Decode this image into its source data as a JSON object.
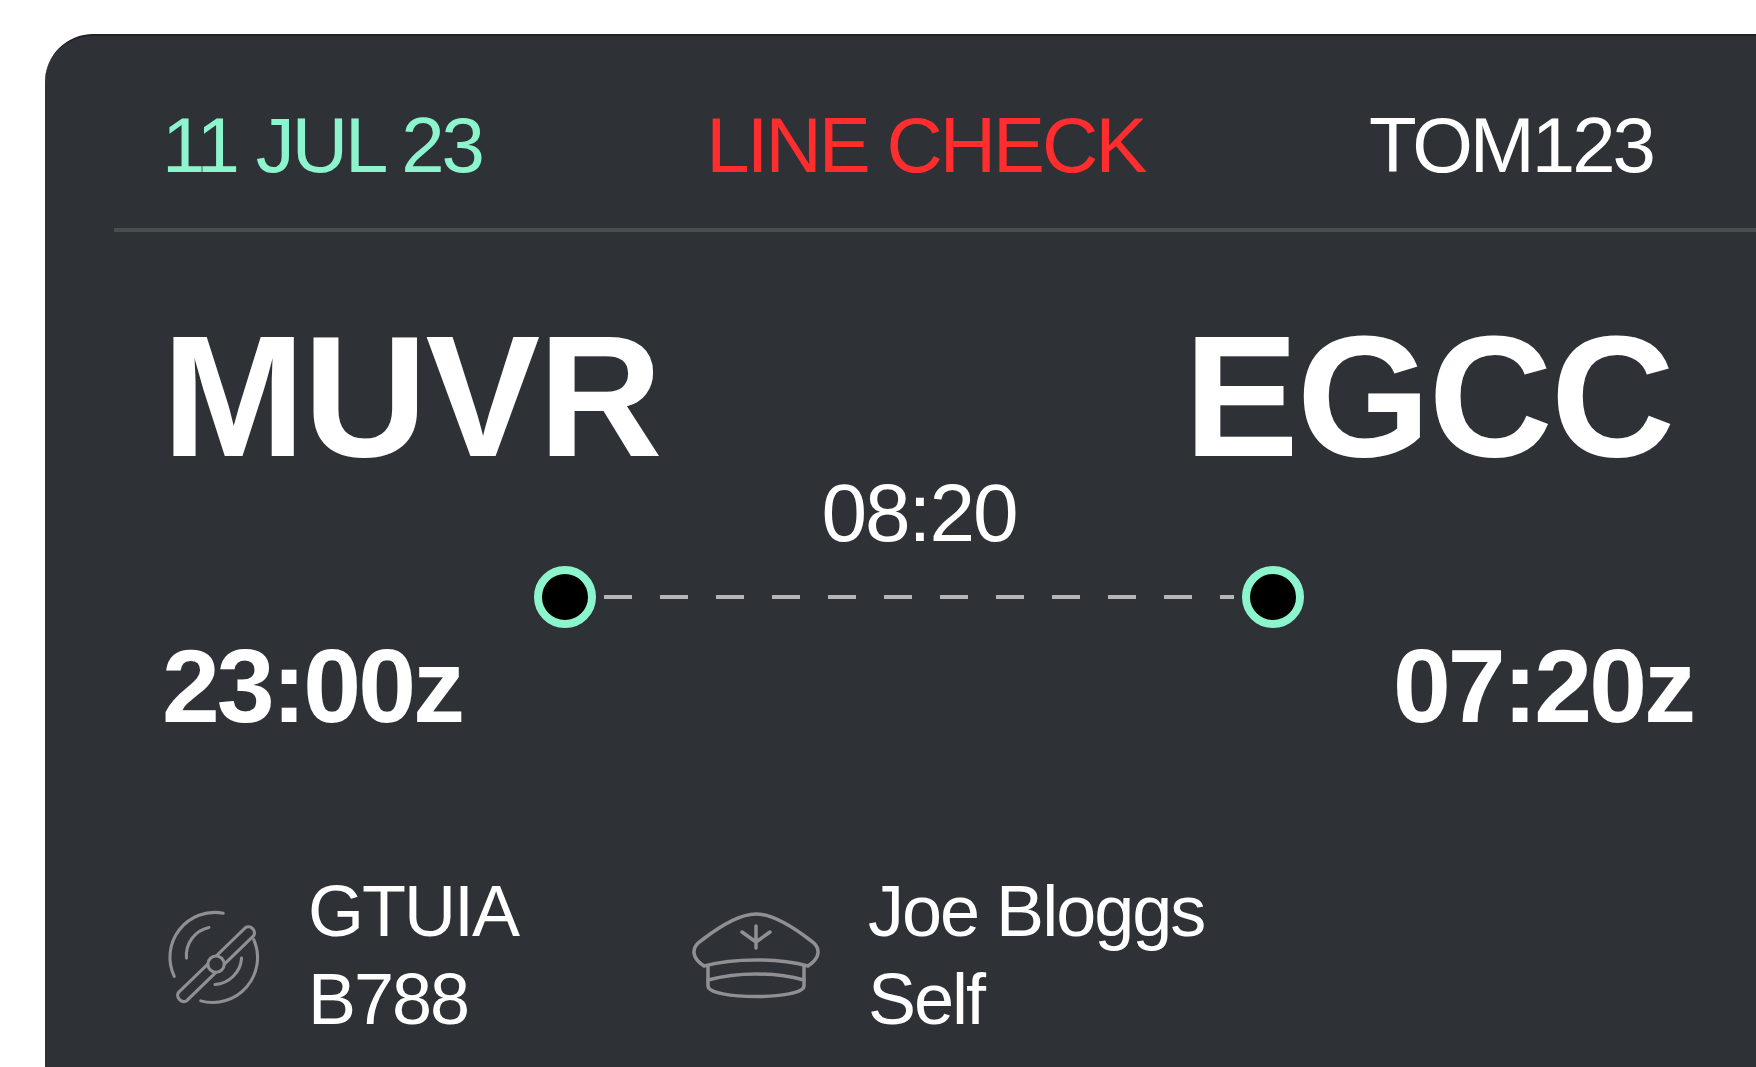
{
  "header": {
    "date": "11 JUL 23",
    "status": "LINE CHECK",
    "flight": "TOM123"
  },
  "route": {
    "origin": {
      "code": "MUVR",
      "time": "23:00z"
    },
    "destination": {
      "code": "EGCC",
      "time": "07:20z"
    },
    "duration": "08:20"
  },
  "aircraft": {
    "registration": "GTUIA",
    "type": "B788"
  },
  "crew": {
    "name": "Joe Bloggs",
    "role": "Self"
  }
}
